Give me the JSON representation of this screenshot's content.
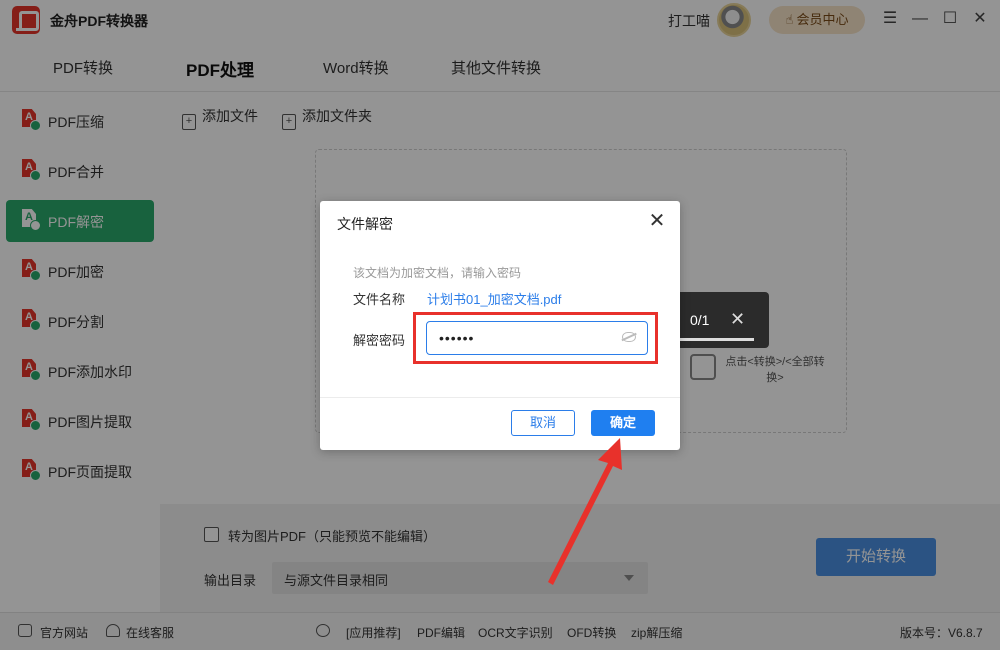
{
  "app": {
    "title": "金舟PDF转换器",
    "username": "打工喵",
    "vip_label": "会员中心"
  },
  "tabs": [
    {
      "label": "PDF转换"
    },
    {
      "label": "PDF处理"
    },
    {
      "label": "Word转换"
    },
    {
      "label": "其他文件转换"
    }
  ],
  "sidebar": {
    "items": [
      {
        "label": "PDF压缩"
      },
      {
        "label": "PDF合并"
      },
      {
        "label": "PDF解密"
      },
      {
        "label": "PDF加密"
      },
      {
        "label": "PDF分割"
      },
      {
        "label": "PDF添加水印"
      },
      {
        "label": "PDF图片提取"
      },
      {
        "label": "PDF页面提取"
      }
    ],
    "active_index": 2
  },
  "toolbar": {
    "add_file": "添加文件",
    "add_folder": "添加文件夹"
  },
  "dropzone": {
    "hint": "点击<转换>/<全部转换>"
  },
  "progress": {
    "count": "0/1"
  },
  "options": {
    "image_pdf_label": "转为图片PDF（只能预览不能编辑）",
    "output_dir_label": "输出目录",
    "output_dir_value": "与源文件目录相同",
    "start_button": "开始转换"
  },
  "statusbar": {
    "official_site": "官方网站",
    "online_service": "在线客服",
    "recommend": "[应用推荐]",
    "links": [
      "PDF编辑",
      "OCR文字识别",
      "OFD转换",
      "zip解压缩"
    ],
    "version": "版本号：V6.8.7"
  },
  "dialog": {
    "title": "文件解密",
    "hint": "该文档为加密文档，请输入密码",
    "filename_label": "文件名称",
    "filename_value": "计划书01_加密文档.pdf",
    "password_label": "解密密码",
    "password_value": "••••••",
    "cancel": "取消",
    "ok": "确定"
  },
  "colors": {
    "accent_green": "#2aa96b",
    "accent_blue": "#1f7ff0",
    "highlight_red": "#e8312b",
    "pdf_red": "#e5342a"
  }
}
